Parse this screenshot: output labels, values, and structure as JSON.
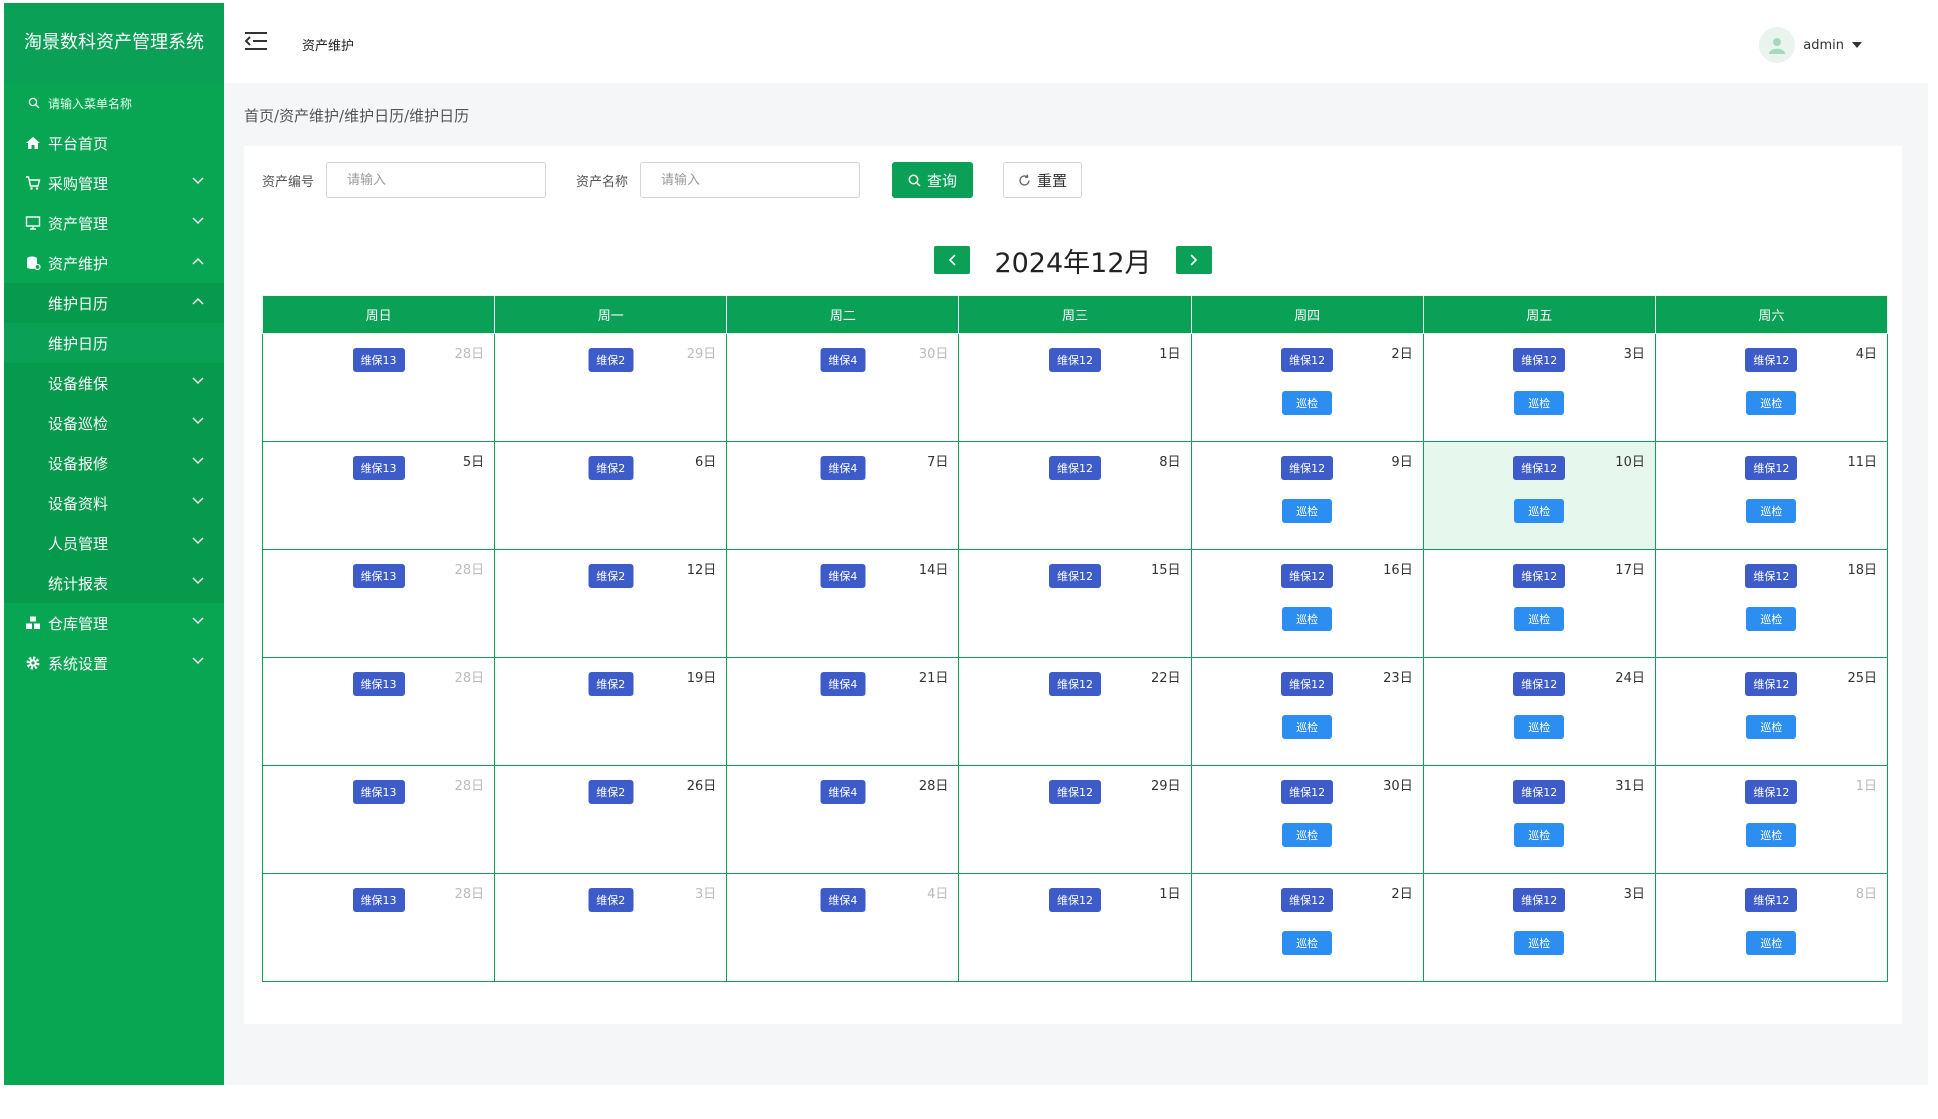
{
  "app": {
    "title": "淘景数科资产管理系统"
  },
  "sidebar": {
    "search_placeholder": "请输入菜单名称",
    "menu": [
      {
        "label": "平台首页",
        "icon": "home-icon"
      },
      {
        "label": "采购管理",
        "icon": "cart-icon"
      },
      {
        "label": "资产管理",
        "icon": "monitor-icon"
      },
      {
        "label": "资产维护",
        "icon": "database-icon"
      }
    ],
    "submenu": [
      {
        "label": "维护日历"
      },
      {
        "label": "设备维保"
      },
      {
        "label": "设备巡检"
      },
      {
        "label": "设备报修"
      },
      {
        "label": "设备资料"
      },
      {
        "label": "人员管理"
      },
      {
        "label": "统计报表"
      }
    ],
    "subsub": {
      "label": "维护日历"
    },
    "menu_bottom": [
      {
        "label": "仓库管理",
        "icon": "warehouse-icon"
      },
      {
        "label": "系统设置",
        "icon": "gear-icon"
      }
    ]
  },
  "header": {
    "page_title": "资产维护",
    "user": "admin"
  },
  "breadcrumb": "首页/资产维护/维护日历/维护日历",
  "filters": {
    "asset_code_label": "资产编号",
    "asset_name_label": "资产名称",
    "placeholder": "请输入",
    "query_label": "查询",
    "reset_label": "重置"
  },
  "calendar": {
    "title": "2024年12月",
    "weekdays": [
      "周日",
      "周一",
      "周二",
      "周三",
      "周四",
      "周五",
      "周六"
    ],
    "weeks": [
      [
        {
          "day": "28日",
          "dim": true,
          "events": [
            "维保13"
          ]
        },
        {
          "day": "29日",
          "dim": true,
          "events": [
            "维保2"
          ]
        },
        {
          "day": "30日",
          "dim": true,
          "events": [
            "维保4"
          ]
        },
        {
          "day": "1日",
          "events": [
            "维保12"
          ]
        },
        {
          "day": "2日",
          "events": [
            "维保12",
            "巡检"
          ]
        },
        {
          "day": "3日",
          "events": [
            "维保12",
            "巡检"
          ]
        },
        {
          "day": "4日",
          "events": [
            "维保12",
            "巡检"
          ]
        }
      ],
      [
        {
          "day": "5日",
          "events": [
            "维保13"
          ]
        },
        {
          "day": "6日",
          "events": [
            "维保2"
          ]
        },
        {
          "day": "7日",
          "events": [
            "维保4"
          ]
        },
        {
          "day": "8日",
          "events": [
            "维保12"
          ]
        },
        {
          "day": "9日",
          "events": [
            "维保12",
            "巡检"
          ]
        },
        {
          "day": "10日",
          "today": true,
          "events": [
            "维保12",
            "巡检"
          ]
        },
        {
          "day": "11日",
          "events": [
            "维保12",
            "巡检"
          ]
        }
      ],
      [
        {
          "day": "28日",
          "dim": true,
          "events": [
            "维保13"
          ]
        },
        {
          "day": "12日",
          "events": [
            "维保2"
          ]
        },
        {
          "day": "14日",
          "events": [
            "维保4"
          ]
        },
        {
          "day": "15日",
          "events": [
            "维保12"
          ]
        },
        {
          "day": "16日",
          "events": [
            "维保12",
            "巡检"
          ]
        },
        {
          "day": "17日",
          "events": [
            "维保12",
            "巡检"
          ]
        },
        {
          "day": "18日",
          "events": [
            "维保12",
            "巡检"
          ]
        }
      ],
      [
        {
          "day": "28日",
          "dim": true,
          "events": [
            "维保13"
          ]
        },
        {
          "day": "19日",
          "events": [
            "维保2"
          ]
        },
        {
          "day": "21日",
          "events": [
            "维保4"
          ]
        },
        {
          "day": "22日",
          "events": [
            "维保12"
          ]
        },
        {
          "day": "23日",
          "events": [
            "维保12",
            "巡检"
          ]
        },
        {
          "day": "24日",
          "events": [
            "维保12",
            "巡检"
          ]
        },
        {
          "day": "25日",
          "events": [
            "维保12",
            "巡检"
          ]
        }
      ],
      [
        {
          "day": "28日",
          "dim": true,
          "events": [
            "维保13"
          ]
        },
        {
          "day": "26日",
          "events": [
            "维保2"
          ]
        },
        {
          "day": "28日",
          "events": [
            "维保4"
          ]
        },
        {
          "day": "29日",
          "events": [
            "维保12"
          ]
        },
        {
          "day": "30日",
          "events": [
            "维保12",
            "巡检"
          ]
        },
        {
          "day": "31日",
          "events": [
            "维保12",
            "巡检"
          ]
        },
        {
          "day": "1日",
          "dim": true,
          "events": [
            "维保12",
            "巡检"
          ]
        }
      ],
      [
        {
          "day": "28日",
          "dim": true,
          "events": [
            "维保13"
          ]
        },
        {
          "day": "3日",
          "dim": true,
          "events": [
            "维保2"
          ]
        },
        {
          "day": "4日",
          "dim": true,
          "events": [
            "维保4"
          ]
        },
        {
          "day": "1日",
          "events": [
            "维保12"
          ]
        },
        {
          "day": "2日",
          "events": [
            "维保12",
            "巡检"
          ]
        },
        {
          "day": "3日",
          "events": [
            "维保12",
            "巡检"
          ]
        },
        {
          "day": "8日",
          "dim": true,
          "events": [
            "维保12",
            "巡检"
          ]
        }
      ]
    ]
  }
}
